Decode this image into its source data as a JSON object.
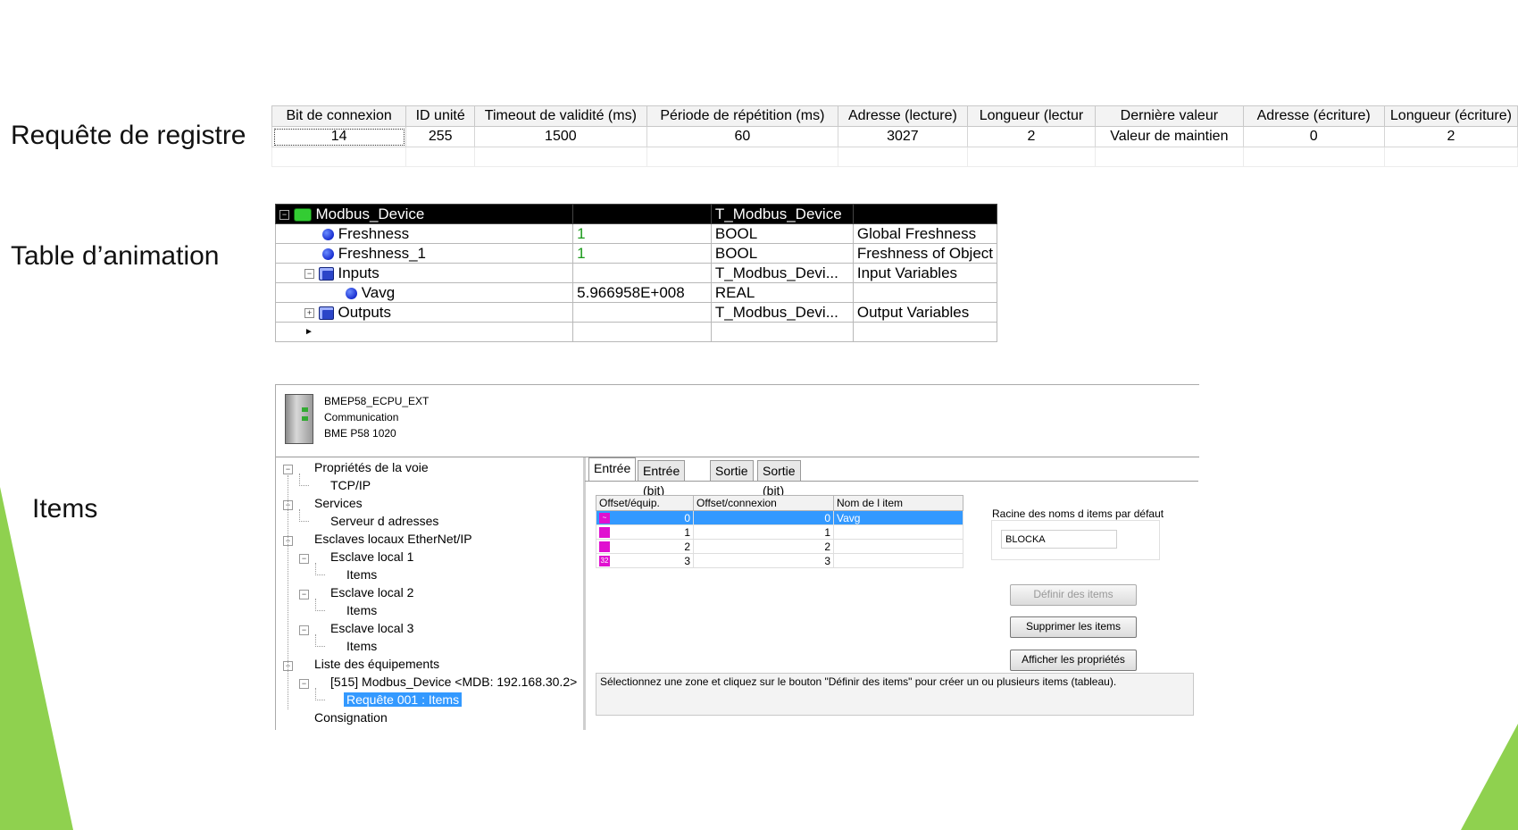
{
  "labels": {
    "register_request": "Requête de registre",
    "animation_table": "Table d’animation",
    "items": "Items"
  },
  "register_grid": {
    "columns": [
      "Bit de connexion",
      "ID unité",
      "Timeout de validité (ms)",
      "Période de répétition (ms)",
      "Adresse (lecture)",
      "Longueur (lectur",
      "Dernière valeur",
      "Adresse (écriture)",
      "Longueur (écriture)"
    ],
    "row": [
      "14",
      "255",
      "1500",
      "60",
      "3027",
      "2",
      "Valeur de maintien",
      "0",
      "2"
    ]
  },
  "animation_table": {
    "rows": [
      {
        "name": "Modbus_Device",
        "value": "",
        "type": "T_Modbus_Device",
        "comment": ""
      },
      {
        "name": "Freshness",
        "value": "1",
        "type": "BOOL",
        "comment": "Global Freshness"
      },
      {
        "name": "Freshness_1",
        "value": "1",
        "type": "BOOL",
        "comment": "Freshness of Object"
      },
      {
        "name": "Inputs",
        "value": "",
        "type": "T_Modbus_Devi...",
        "comment": "Input Variables"
      },
      {
        "name": "Vavg",
        "value": "5.966958E+008",
        "type": "REAL",
        "comment": ""
      },
      {
        "name": "Outputs",
        "value": "",
        "type": "T_Modbus_Devi...",
        "comment": "Output Variables"
      }
    ]
  },
  "device_header": {
    "line1": "BMEP58_ECPU_EXT",
    "line2": "Communication",
    "line3": "BME P58 1020"
  },
  "tree": [
    "Propriétés de la voie",
    "TCP/IP",
    "Services",
    "Serveur d adresses",
    "Esclaves locaux EtherNet/IP",
    "Esclave local 1",
    "Items",
    "Esclave local 2",
    "Items",
    "Esclave local 3",
    "Items",
    "Liste des équipements",
    "[515] Modbus_Device <MDB: 192.168.30.2>",
    "Requête 001 : Items",
    "Consignation"
  ],
  "tabs": [
    "Entrée",
    "Entrée (bit)",
    "Sortie",
    "Sortie (bit)"
  ],
  "item_grid": {
    "columns": [
      "Offset/équip.",
      "Offset/connexion",
      "Nom de l item"
    ],
    "markers": [
      "~",
      "",
      "",
      "32"
    ],
    "rows": [
      [
        "0",
        "0",
        "Vavg"
      ],
      [
        "1",
        "1",
        ""
      ],
      [
        "2",
        "2",
        ""
      ],
      [
        "3",
        "3",
        ""
      ]
    ]
  },
  "root_label": "Racine des noms d items par défaut",
  "root_value": "BLOCKA",
  "buttons": {
    "define": "Définir des items",
    "delete": "Supprimer les items",
    "props": "Afficher les propriétés"
  },
  "message": "Sélectionnez une zone et cliquez sur le bouton \"Définir des items\" pour créer un ou plusieurs items (tableau).",
  "colors": {
    "accent": "#3399ff",
    "green_triangle": "#8fd14f",
    "marker": "#e010d0"
  }
}
